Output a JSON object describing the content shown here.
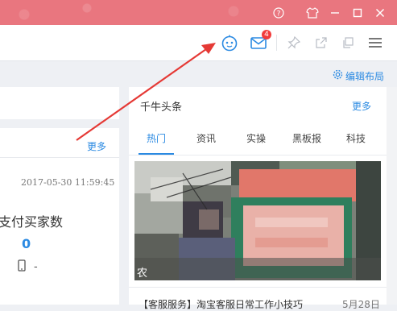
{
  "window": {
    "controls": [
      "help-icon",
      "skin-icon",
      "minimize-icon",
      "maximize-icon",
      "close-icon"
    ]
  },
  "toolbar": {
    "robot_icon": "robot-face-icon",
    "mail_icon": "mail-icon",
    "mail_badge": "4",
    "pin_icon": "pin-icon",
    "popout_icon": "popout-icon",
    "copy_icon": "copy-window-icon",
    "menu_icon": "hamburger-menu-icon"
  },
  "layout_edit": {
    "label": "编辑布局"
  },
  "left_panel": {
    "more_label": "更多",
    "date": "2017-05-30 11:59:45",
    "pay_label": "支付买家数",
    "pay_value": "0",
    "phone_value": "-"
  },
  "right_panel": {
    "title": "千牛头条",
    "more_label": "更多",
    "tabs": [
      "热门",
      "资讯",
      "实操",
      "黑板报",
      "科技"
    ],
    "active_tab": "热门",
    "image_caption": "农",
    "news": [
      {
        "title": "【客服服务】淘宝客服日常工作小技巧",
        "date": "5月28日"
      }
    ]
  },
  "colors": {
    "titlebar": "#e9767f",
    "accent": "#2b8ae2",
    "badge": "#f23c3c",
    "annotation_arrow": "#e53935"
  }
}
